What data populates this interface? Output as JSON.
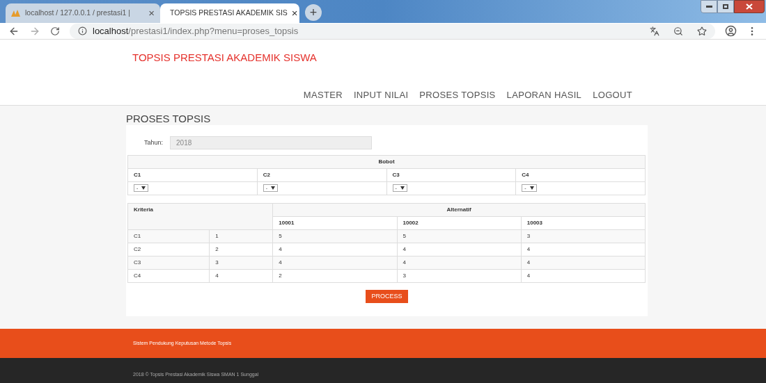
{
  "browser": {
    "tabs": [
      {
        "title": "localhost / 127.0.0.1 / prestasi1 |",
        "selected": false,
        "close": "×"
      },
      {
        "title": "TOPSIS PRESTASI AKADEMIK SIS",
        "selected": true,
        "close": "×"
      }
    ],
    "new_tab": "+",
    "url_host": "localhost",
    "url_path": "/prestasi1/index.php?menu=proses_topsis"
  },
  "site_title": "TOPSIS PRESTASI AKADEMIK SISWA",
  "nav": [
    "MASTER",
    "INPUT NILAI",
    "PROSES TOPSIS",
    "LAPORAN HASIL",
    "LOGOUT"
  ],
  "page_heading": "PROSES TOPSIS",
  "year": {
    "label": "Tahun:",
    "value": "2018"
  },
  "bobot": {
    "title": "Bobot",
    "criteria": [
      {
        "name": "C1",
        "value": "-"
      },
      {
        "name": "C2",
        "value": "-"
      },
      {
        "name": "C3",
        "value": "-"
      },
      {
        "name": "C4",
        "value": "-"
      }
    ]
  },
  "matrix": {
    "criteria_header": "Kriteria",
    "alt_header": "Alternatif",
    "alternatives": [
      "10001",
      "10002",
      "10003"
    ],
    "rows": [
      {
        "criterion": "C1",
        "weight": "1",
        "values": [
          "5",
          "5",
          "3"
        ]
      },
      {
        "criterion": "C2",
        "weight": "2",
        "values": [
          "4",
          "4",
          "4"
        ]
      },
      {
        "criterion": "C3",
        "weight": "3",
        "values": [
          "4",
          "4",
          "4"
        ]
      },
      {
        "criterion": "C4",
        "weight": "4",
        "values": [
          "2",
          "3",
          "4"
        ]
      }
    ]
  },
  "process_button": "PROCESS",
  "footer_text": "Sistem Pendukung Keputusan Metode Topsis",
  "copyright": "2018 © Topsis Prestasi Akademik Siswa SMAN 1 Sunggal"
}
